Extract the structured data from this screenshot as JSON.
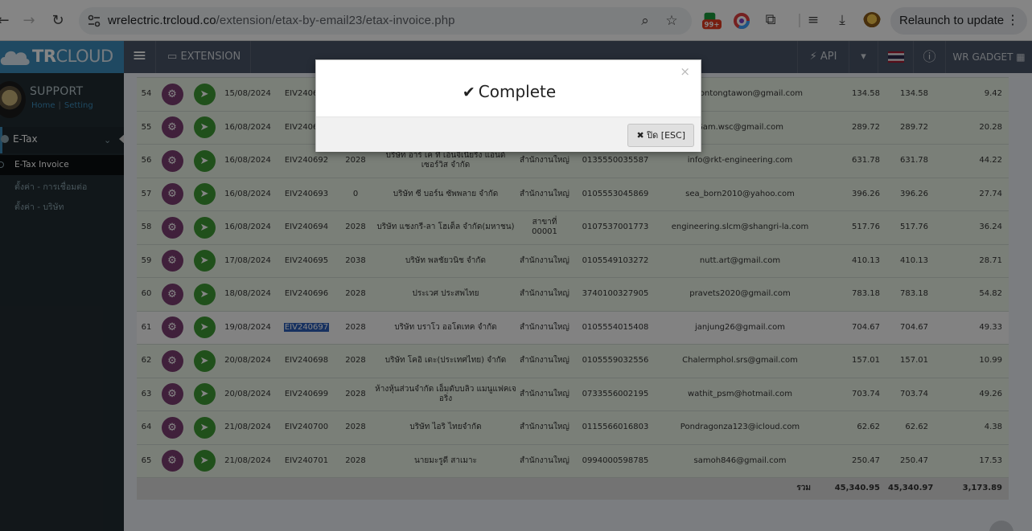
{
  "browser": {
    "url_host": "wrelectric.trcloud.co",
    "url_path": "/extension/etax-by-email23/etax-invoice.php",
    "badge_count": "99+",
    "relaunch_label": "Relaunch to update"
  },
  "header": {
    "logo_bold": "TR",
    "logo_rest": "CLOUD",
    "extension_label": "EXTENSION",
    "api_label": "API",
    "gadget_label": "WR GADGET"
  },
  "sidebar": {
    "user_name": "SUPPORT",
    "link_home": "Home",
    "link_sep": "|",
    "link_setting": "Setting",
    "menu_etax": "E-Tax",
    "items": [
      {
        "label": "E-Tax Invoice"
      },
      {
        "label": "ตั้งค่า - การเชื่อมต่อ"
      },
      {
        "label": "ตั้งค่า - บริษัท"
      }
    ]
  },
  "table": {
    "rows": [
      {
        "no": "54",
        "date": "15/08/2024",
        "doc": "EIV240690",
        "code": "",
        "name": "",
        "branch": "",
        "tax": "",
        "email": "gkamontongtawon@gmail.com",
        "a1": "134.58",
        "a2": "134.58",
        "vat": "9.42"
      },
      {
        "no": "55",
        "date": "16/08/2024",
        "doc": "EIV240691",
        "code": "",
        "name": "",
        "branch": "",
        "tax": "",
        "email": "Gam.wsc@gmail.com",
        "a1": "289.72",
        "a2": "289.72",
        "vat": "20.28"
      },
      {
        "no": "56",
        "date": "16/08/2024",
        "doc": "EIV240692",
        "code": "2028",
        "name": "บริษัท อาร์ เค ที เอ็นจิเนียริ่ง แอนด์ เซอร์วิส จำกัด",
        "branch": "สำนักงานใหญ่",
        "tax": "0135550035587",
        "email": "info@rkt-engineering.com",
        "a1": "631.78",
        "a2": "631.78",
        "vat": "44.22"
      },
      {
        "no": "57",
        "date": "16/08/2024",
        "doc": "EIV240693",
        "code": "0",
        "name": "บริษัท ซี บอร์น ซัพพลาย จำกัด",
        "branch": "สำนักงานใหญ่",
        "tax": "0105553045869",
        "email": "sea_born2010@yahoo.com",
        "a1": "396.26",
        "a2": "396.26",
        "vat": "27.74"
      },
      {
        "no": "58",
        "date": "16/08/2024",
        "doc": "EIV240694",
        "code": "2028",
        "name": "บริษัท แชงกรี-ลา โฮเต็ล จำกัด(มหาชน)",
        "branch": "สาขาที่ 00001",
        "tax": "0107537001773",
        "email": "engineering.slcm@shangri-la.com",
        "a1": "517.76",
        "a2": "517.76",
        "vat": "36.24"
      },
      {
        "no": "59",
        "date": "17/08/2024",
        "doc": "EIV240695",
        "code": "2038",
        "name": "บริษัท พลชัยวนิช จำกัด",
        "branch": "สำนักงานใหญ่",
        "tax": "0105549103272",
        "email": "nutt.art@gmail.com",
        "a1": "410.13",
        "a2": "410.13",
        "vat": "28.71"
      },
      {
        "no": "60",
        "date": "18/08/2024",
        "doc": "EIV240696",
        "code": "2028",
        "name": "ประเวศ ประสพไทย",
        "branch": "สำนักงานใหญ่",
        "tax": "3740100327905",
        "email": "pravets2020@gmail.com",
        "a1": "783.18",
        "a2": "783.18",
        "vat": "54.82"
      },
      {
        "no": "61",
        "date": "19/08/2024",
        "doc": "EIV240697",
        "code": "2028",
        "name": "บริษัท บราโว ออโตเทค จำกัด",
        "branch": "สำนักงานใหญ่",
        "tax": "0105554015408",
        "email": "janjung26@gmail.com",
        "a1": "704.67",
        "a2": "704.67",
        "vat": "49.33"
      },
      {
        "no": "62",
        "date": "20/08/2024",
        "doc": "EIV240698",
        "code": "2028",
        "name": "บริษัท โคอิ เดะ(ประเทศไทย) จำกัด",
        "branch": "สำนักงานใหญ่",
        "tax": "0105559032556",
        "email": "Chalermphol.srs@gmail.com",
        "a1": "157.01",
        "a2": "157.01",
        "vat": "10.99"
      },
      {
        "no": "63",
        "date": "20/08/2024",
        "doc": "EIV240699",
        "code": "2028",
        "name": "ห้างหุ้นส่วนจำกัด เอ็มดับบลิว แมนูแฟคเจอริ่ง",
        "branch": "สำนักงานใหญ่",
        "tax": "0733556002195",
        "email": "wathit_psm@hotmail.com",
        "a1": "703.74",
        "a2": "703.74",
        "vat": "49.26"
      },
      {
        "no": "64",
        "date": "21/08/2024",
        "doc": "EIV240700",
        "code": "2028",
        "name": "บริษัท ไอริ ไทยจำกัด",
        "branch": "สำนักงานใหญ่",
        "tax": "0115566016803",
        "email": "Pondragonza123@icloud.com",
        "a1": "62.62",
        "a2": "62.62",
        "vat": "4.38"
      },
      {
        "no": "65",
        "date": "21/08/2024",
        "doc": "EIV240701",
        "code": "2028",
        "name": "นายมะรูดี สาเมาะ",
        "branch": "สำนักงานใหญ่",
        "tax": "0994000598785",
        "email": "samoh846@gmail.com",
        "a1": "250.47",
        "a2": "250.47",
        "vat": "17.53"
      }
    ],
    "total_label": "รวม",
    "total_a1": "45,340.95",
    "total_a2": "45,340.97",
    "total_vat": "3,173.89"
  },
  "modal": {
    "title": "Complete",
    "close_x": "×",
    "close_button": "ปิด [ESC]"
  },
  "colors": {
    "header": "#4a5568",
    "logo_bg": "#3c8dbc",
    "sidebar": "#222d32",
    "gear_button": "#7b3f72",
    "send_button": "#3f9a35"
  }
}
